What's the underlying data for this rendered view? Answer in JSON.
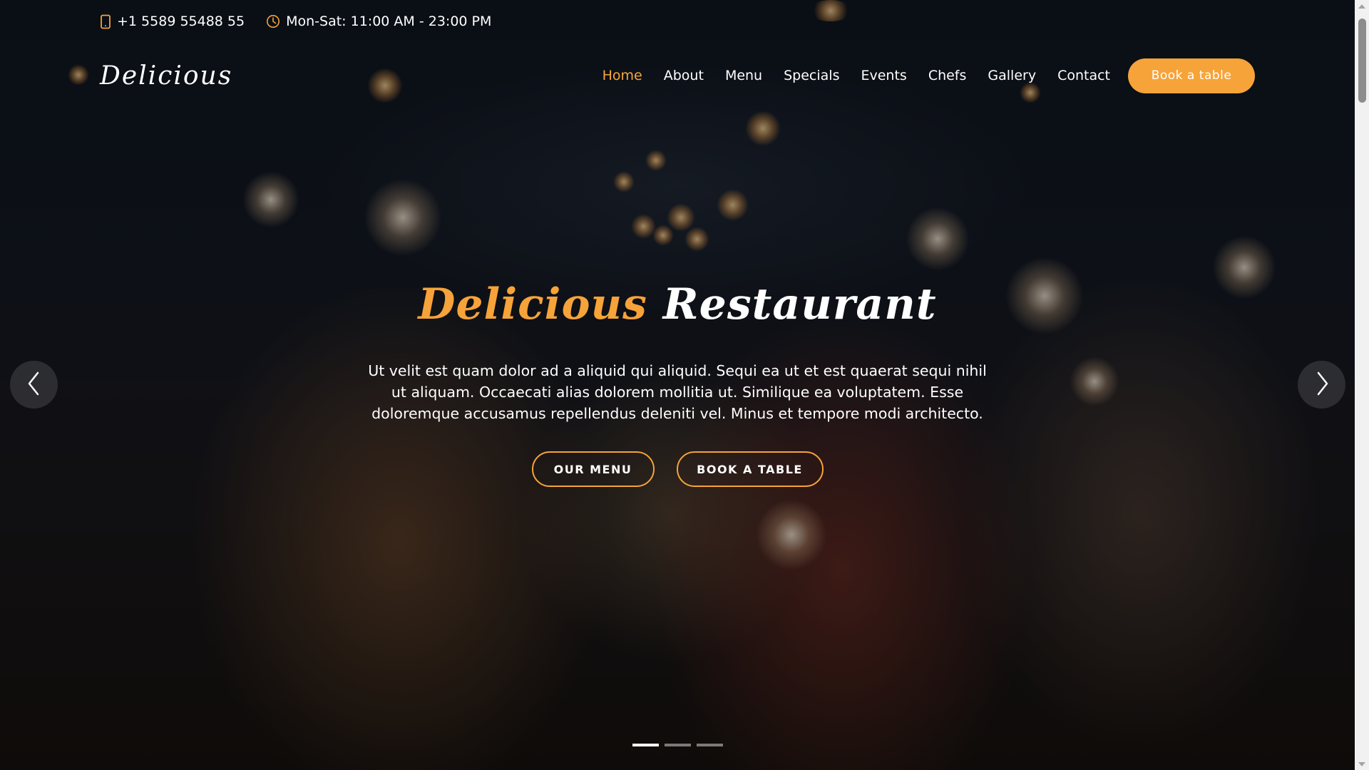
{
  "topbar": {
    "phone": "+1 5589 55488 55",
    "hours": "Mon-Sat: 11:00 AM - 23:00 PM",
    "phone_icon": "phone-icon",
    "clock_icon": "clock-icon"
  },
  "header": {
    "logo": "Delicious",
    "nav": [
      {
        "label": "Home",
        "active": true
      },
      {
        "label": "About"
      },
      {
        "label": "Menu"
      },
      {
        "label": "Specials"
      },
      {
        "label": "Events"
      },
      {
        "label": "Chefs"
      },
      {
        "label": "Gallery"
      },
      {
        "label": "Contact"
      }
    ],
    "book_button": "Book a table"
  },
  "hero": {
    "title_accent": "Delicious",
    "title_rest": "Restaurant",
    "text": "Ut velit est quam dolor ad a aliquid qui aliquid. Sequi ea ut et est quaerat sequi nihil ut aliquam. Occaecati alias dolorem mollitia ut. Similique ea voluptatem. Esse doloremque accusamus repellendus deleniti vel. Minus et tempore modi architecto.",
    "menu_button": "OUR MENU",
    "table_button": "BOOK A TABLE"
  },
  "carousel": {
    "prev_icon": "chevron-left-icon",
    "next_icon": "chevron-right-icon",
    "slides": 3,
    "active_slide": 1
  },
  "colors": {
    "accent": "#f6a33a",
    "text": "#ffffff"
  }
}
